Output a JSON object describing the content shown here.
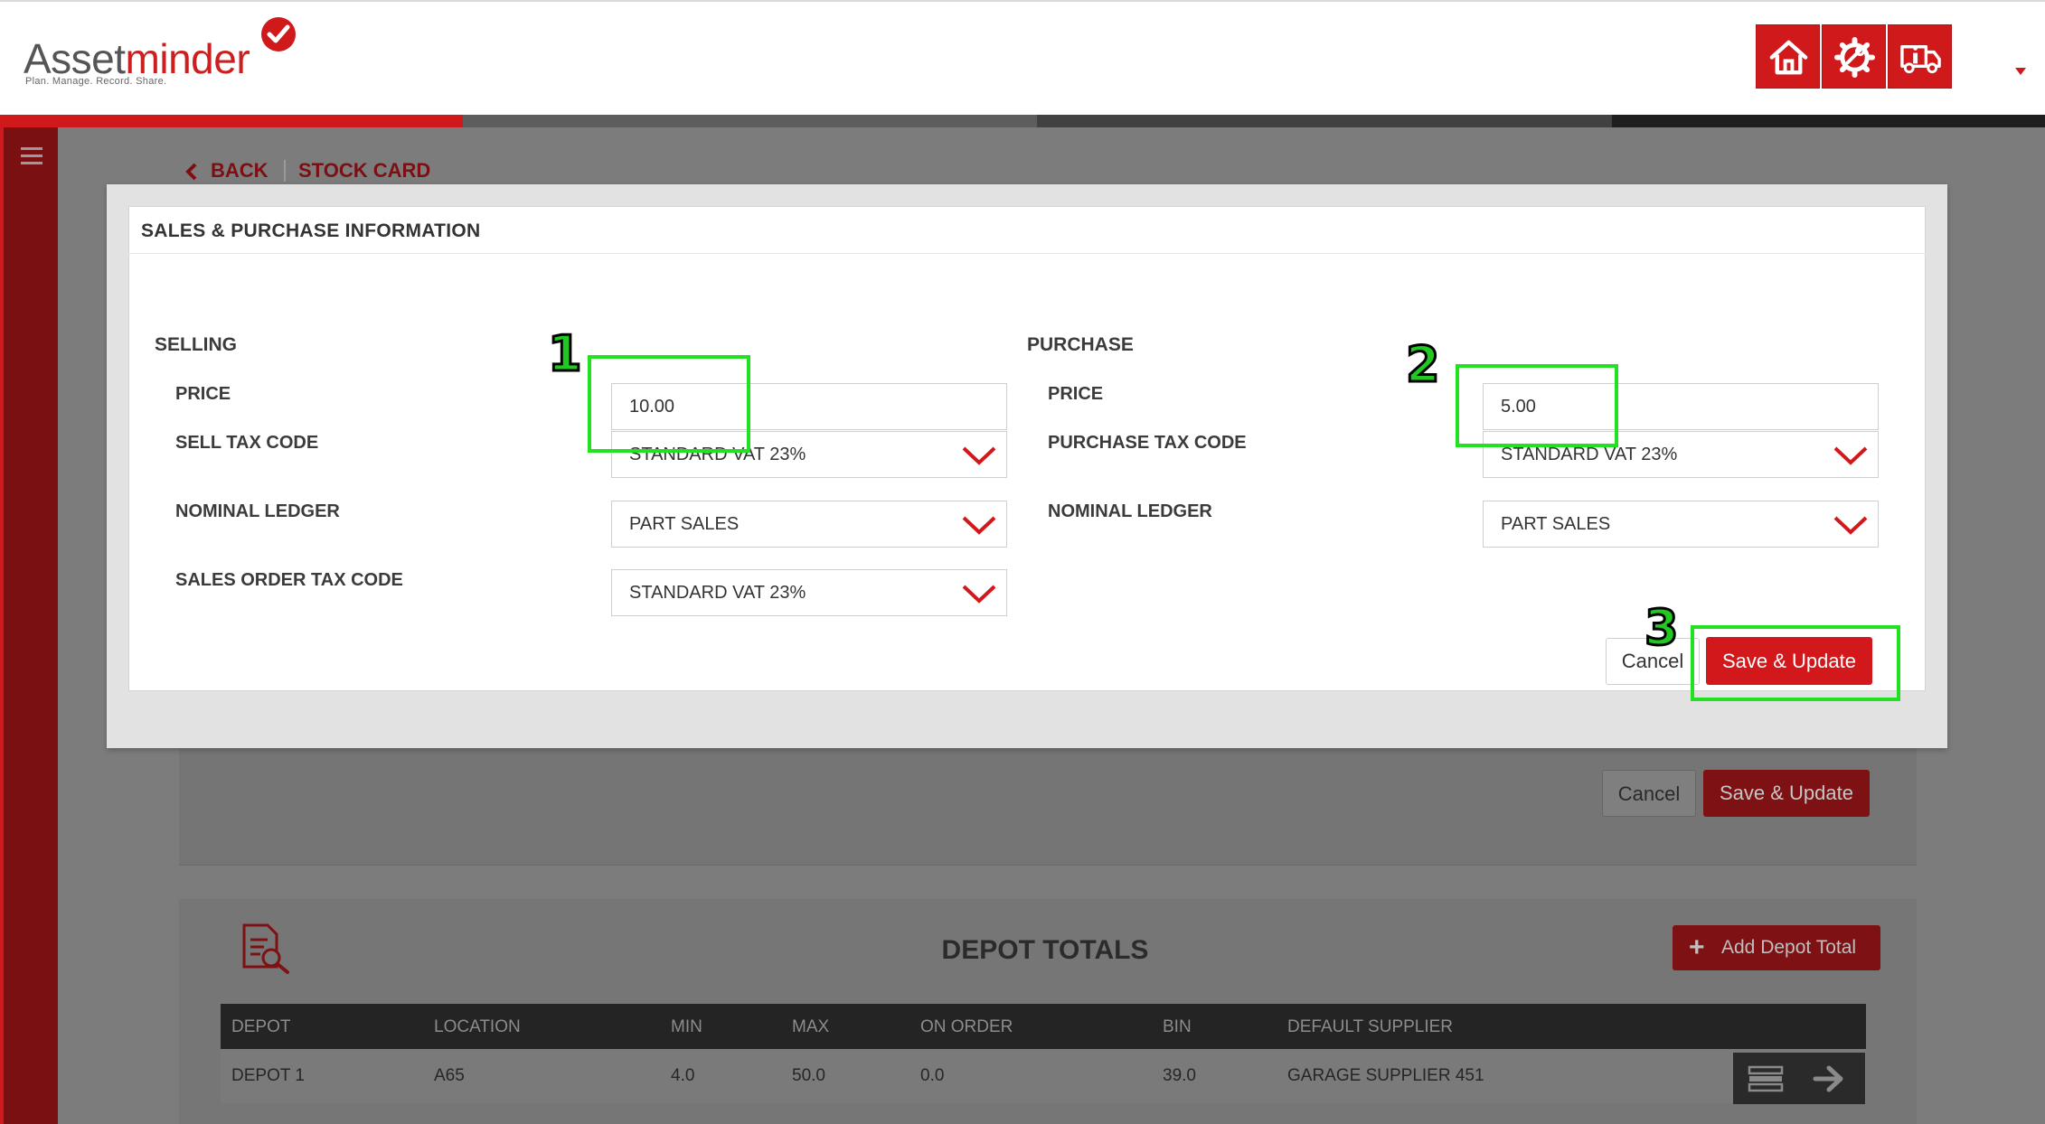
{
  "header": {
    "logo": {
      "part1": "Asset",
      "part2": "minder",
      "tagline": "Plan. Manage. Record. Share."
    },
    "buttons": [
      {
        "icon": "home-icon"
      },
      {
        "icon": "settings-gear-icon"
      },
      {
        "icon": "truck-info-icon"
      }
    ]
  },
  "breadcrumb": {
    "back": "BACK",
    "current": "STOCK CARD"
  },
  "modal": {
    "title": "SALES & PURCHASE INFORMATION",
    "selling": {
      "heading": "SELLING",
      "price_label": "PRICE",
      "price_value": "10.00",
      "sell_tax_label": "SELL TAX CODE",
      "sell_tax_value": "STANDARD VAT 23%",
      "nominal_label": "NOMINAL LEDGER",
      "nominal_value": "PART SALES",
      "sales_order_tax_label": "SALES ORDER TAX CODE",
      "sales_order_tax_value": "STANDARD VAT 23%"
    },
    "purchase": {
      "heading": "PURCHASE",
      "price_label": "PRICE",
      "price_value": "5.00",
      "purchase_tax_label": "PURCHASE TAX CODE",
      "purchase_tax_value": "STANDARD VAT 23%",
      "nominal_label": "NOMINAL LEDGER",
      "nominal_value": "PART SALES"
    },
    "cancel_label": "Cancel",
    "save_label": "Save & Update"
  },
  "background": {
    "cancel_label": "Cancel",
    "save_label": "Save & Update",
    "depot": {
      "title": "DEPOT TOTALS",
      "add_label": "Add Depot Total",
      "columns": [
        "DEPOT",
        "LOCATION",
        "MIN",
        "MAX",
        "ON ORDER",
        "BIN",
        "DEFAULT SUPPLIER"
      ],
      "rows": [
        [
          "DEPOT 1",
          "A65",
          "4.0",
          "50.0",
          "0.0",
          "39.0",
          "GARAGE SUPPLIER 451"
        ]
      ]
    }
  },
  "annotations": [
    "1",
    "2",
    "3"
  ],
  "colors": {
    "brand_red": "#d0191b",
    "dark_red": "#7a1012",
    "annotation_green": "#22e022"
  }
}
